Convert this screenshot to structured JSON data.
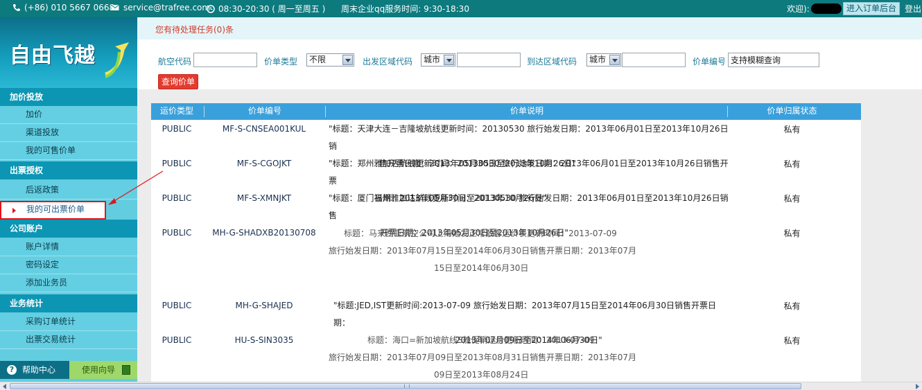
{
  "topbar": {
    "phone": "(+86) 010 5667 0668",
    "email": "service@trafree.com",
    "hours": "08:30-20:30 ( 周一至周五 )",
    "weekend_hours": "周末企业qq服务时间: 9:30-18:30",
    "welcome": "欢迎):",
    "orders_button": "进入订单后台",
    "logout": "登出"
  },
  "sidebar": {
    "logo": "自由飞越",
    "sections": [
      {
        "title": "加价投放",
        "items": [
          "加价",
          "渠道投放",
          "我的可售价单"
        ]
      },
      {
        "title": "出票授权",
        "items": [
          "后返政策",
          "我的可出票价单"
        ]
      },
      {
        "title": "公司账户",
        "items": [
          "账户详情",
          "密码设定",
          "添加业务员"
        ]
      },
      {
        "title": "业务统计",
        "items": [
          "采购订单统计",
          "出票交易统计"
        ]
      }
    ],
    "active_item": "我的可出票价单",
    "footer": {
      "help": "帮助中心",
      "guide": "使用向导"
    }
  },
  "notice": "您有待处理任务(0)条",
  "search": {
    "airline_label": "航空代码",
    "airline_value": "",
    "type_label": "价单类型",
    "type_value": "不限",
    "origin_label": "出发区域代码",
    "origin_scope": "城市",
    "origin_value": "",
    "dest_label": "到达区域代码",
    "dest_scope": "城市",
    "dest_value": "",
    "id_label": "价单编号",
    "id_value": "支持模糊查询",
    "query_button": "查询价单"
  },
  "table": {
    "columns": [
      "运价类型",
      "价单编号",
      "价单说明",
      "价单归属状态"
    ],
    "rows": [
      {
        "type": "PUBLIC",
        "id": "MF-S-CNSEA001KUL",
        "desc1": "\"标题：天津大连－吉隆坡航线更新时间：20130530 旅行始发日期：2013年06月01日至2013年10月26日销",
        "desc2": "售开票日期：2013年05月30日至2013年10月26日\"",
        "desc3": "",
        "status": "私有"
      },
      {
        "type": "PUBLIC",
        "id": "MF-S-CGOJKT",
        "desc1": "\"标题：郑州雅加达航线更新时间：20130530 旅行始发日期：2013年06月01日至2013年10月26日销售开票",
        "desc2": "日期：2013年05月30日至2013年10月26日\"",
        "desc3": "",
        "status": "私有"
      },
      {
        "type": "PUBLIC",
        "id": "MF-S-XMNJKT",
        "desc1": "\"标题：厦门福州雅加达航线更新时间：20130530 旅行始发日期：2013年06月01日至2013年10月26日销售",
        "desc2": "开票日期：2013年05月30日至2013年10月26日\"",
        "desc3": "",
        "status": "私有"
      },
      {
        "type": "PUBLIC",
        "id": "MH-G-SHADXB20130708",
        "desc1": "标题：马来西亚航空公司上海始发正常散客运价表更新时间：2013-07-09",
        "desc2": "旅行始发日期：2013年07月15日至2014年06月30日销售开票日期：2013年07月",
        "desc3": "15日至2014年06月30日",
        "status": "私有"
      },
      {
        "type": "PUBLIC",
        "id": "MH-G-SHAJED",
        "desc1": "\"标题:JED,IST更新时间:2013-07-09 旅行始发日期：2013年07月15日至2014年06月30日销售开票日期：",
        "desc2": "2013年07月09日至2014年06月30日\"",
        "desc3": "",
        "status": "私有"
      },
      {
        "type": "PUBLIC",
        "id": "HU-S-SIN3035",
        "desc1": "标题：海口=新加坡航线S舱促销运价更新时间：2013-07-09",
        "desc2": "旅行始发日期：2013年07月09日至2013年08月31日销售开票日期：2013年07月",
        "desc3": "09日至2013年08月24日",
        "status": "私有"
      }
    ]
  },
  "colors": {
    "topbar": "#0d7a7e",
    "sidebar": "#63cde0",
    "section_head": "#0c96b4",
    "table_head": "#3aa0dc",
    "highlight": "#e0151b"
  }
}
